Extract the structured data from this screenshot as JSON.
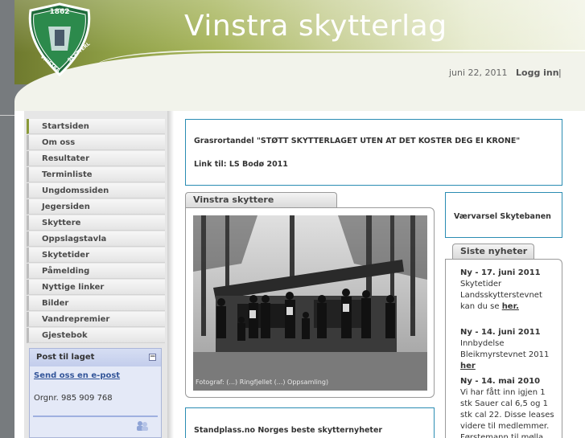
{
  "header": {
    "logo_year": "1862",
    "logo_text": "VINSTRA SKYTTERLAG",
    "site_title": "Vinstra skytterlag",
    "date": "juni 22, 2011",
    "login_label": "Logg inn",
    "login_separator": "|"
  },
  "nav": {
    "items": [
      {
        "label": "Startsiden"
      },
      {
        "label": "Om oss"
      },
      {
        "label": "Resultater"
      },
      {
        "label": "Terminliste"
      },
      {
        "label": "Ungdomssiden"
      },
      {
        "label": "Jegersiden"
      },
      {
        "label": "Skyttere"
      },
      {
        "label": "Oppslagstavla"
      },
      {
        "label": "Skytetider"
      },
      {
        "label": "Påmelding"
      },
      {
        "label": "Nyttige linker"
      },
      {
        "label": "Bilder"
      },
      {
        "label": "Vandrepremier"
      },
      {
        "label": "Gjestebok"
      }
    ]
  },
  "post_box": {
    "title": "Post til laget",
    "collapse_symbol": "−",
    "email_link": "Send oss en e-post",
    "org_number": "Orgnr. 985 909 768"
  },
  "announcement": {
    "text": "Grasrortandel \"STØTT SKYTTERLAGET UTEN AT DET KOSTER DEG EI KRONE\"",
    "link": "Link til: LS Bodø 2011"
  },
  "photo_panel": {
    "tab_label": "Vinstra skyttere",
    "caption": "Fotograf: (...) Ringfjellet (...) Oppsamling)"
  },
  "weather": {
    "label": "Værvarsel Skytebanen"
  },
  "news": {
    "tab_label": "Siste nyheter",
    "items": [
      {
        "title": "Ny - 17. juni 2011",
        "body": "Skytetider Landsskytterstevnet kan du se",
        "more": "her."
      },
      {
        "title": "Ny - 14. juni 2011",
        "body": "Innbydelse Bleikmyrstevnet 2011",
        "more": "her"
      },
      {
        "title": "Ny - 14. mai 2010",
        "body": "Vi har fått inn igjen 1 stk Sauer cal 6,5 og 1 stk cal 22. Disse leases videre til medlemmer. Førstemann til mølla, ring Jon eller",
        "more": ""
      }
    ]
  },
  "standplass": {
    "text": "Standplass.no Norges beste skytternyheter"
  },
  "colors": {
    "header_green": "#8fa046",
    "panel_border_blue": "#2a8cb3",
    "nav_active": "#8a9a39",
    "post_box_bg": "#e4e9f7"
  }
}
